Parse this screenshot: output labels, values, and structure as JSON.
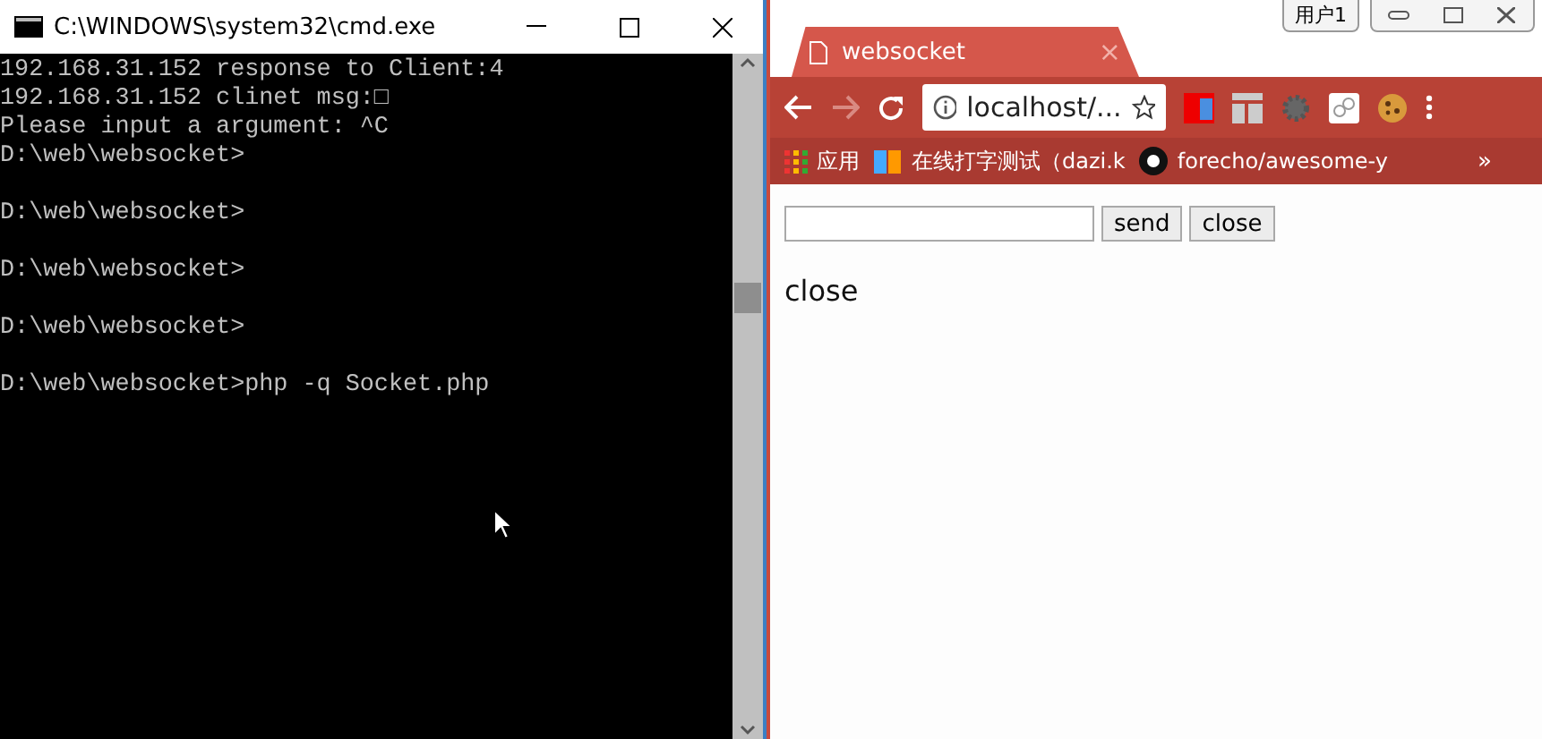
{
  "console_window": {
    "title": "C:\\WINDOWS\\system32\\cmd.exe",
    "paragraphs": [
      [
        "192.168.31.152 response to Client:4",
        "192.168.31.152 clinet msg:□",
        "Please input a argument: ^C",
        "D:\\web\\websocket>"
      ],
      [
        "D:\\web\\websocket>"
      ],
      [
        "D:\\web\\websocket>"
      ],
      [
        "D:\\web\\websocket>"
      ],
      [
        "D:\\web\\websocket>php -q Socket.php"
      ]
    ]
  },
  "browser": {
    "user_badge": "用户1",
    "tab": {
      "title": "websocket",
      "close": "×"
    },
    "address": "localhost/...",
    "bookmarks": [
      {
        "label": "应用",
        "kind": "apps"
      },
      {
        "label": "在线打字测试（dazi.k",
        "kind": "ku"
      },
      {
        "label": "forecho/awesome-y",
        "kind": "github"
      }
    ],
    "more": "»",
    "page": {
      "send": "send",
      "close": "close",
      "status": "close"
    }
  }
}
